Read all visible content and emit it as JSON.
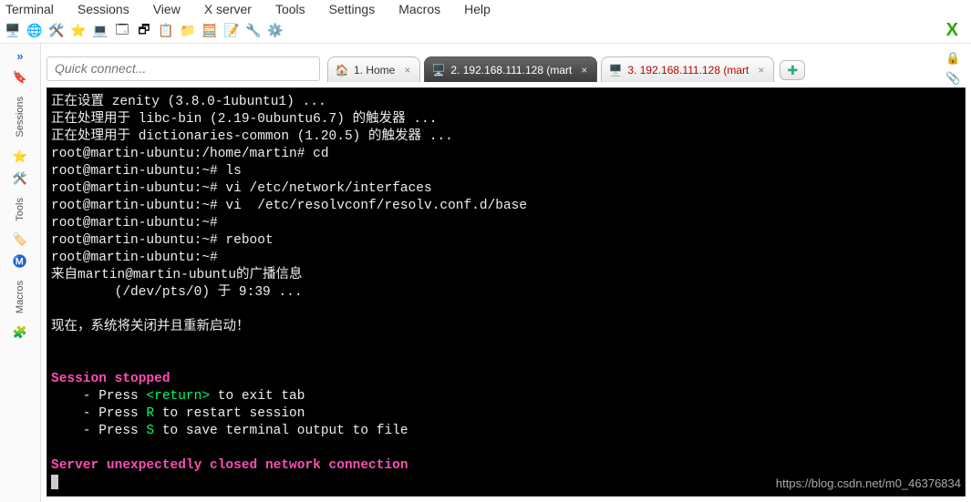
{
  "menubar": [
    "Terminal",
    "Sessions",
    "View",
    "X server",
    "Tools",
    "Settings",
    "Macros",
    "Help"
  ],
  "toolbar_icons": [
    {
      "name": "terminal-icon",
      "glyph": "🖥️"
    },
    {
      "name": "globe-icon",
      "glyph": "🌐"
    },
    {
      "name": "hammer-icon",
      "glyph": "🛠️"
    },
    {
      "name": "star-icon",
      "glyph": "⭐"
    },
    {
      "name": "monitor-icon",
      "glyph": "💻"
    },
    {
      "name": "cascade-icon",
      "glyph": "🗔"
    },
    {
      "name": "tile-icon",
      "glyph": "🗗"
    },
    {
      "name": "note-icon",
      "glyph": "📋"
    },
    {
      "name": "folder-icon",
      "glyph": "📁"
    },
    {
      "name": "calc-icon",
      "glyph": "🧮"
    },
    {
      "name": "edit-icon",
      "glyph": "📝"
    },
    {
      "name": "wrench-icon",
      "glyph": "🔧"
    },
    {
      "name": "gear-icon",
      "glyph": "⚙️"
    }
  ],
  "close_glyph": "X",
  "quick_connect_placeholder": "Quick connect...",
  "left_dock": [
    {
      "icon": "»",
      "name": "expand-icon",
      "label": ""
    },
    {
      "icon": "🔖",
      "name": "bookmark-icon",
      "label": "Sessions"
    },
    {
      "icon": "⭐",
      "name": "star-dock-icon",
      "label": ""
    },
    {
      "icon": "🛠️",
      "name": "tools-dock-icon",
      "label": "Tools"
    },
    {
      "icon": "🏷️",
      "name": "tag-dock-icon",
      "label": ""
    },
    {
      "icon": "Ⓜ️",
      "name": "macros-dock-icon",
      "label": "Macros"
    },
    {
      "icon": "🧩",
      "name": "split-dock-icon",
      "label": ""
    }
  ],
  "tabs": [
    {
      "id": "home",
      "label": "1. Home",
      "icon": "🏠",
      "active": false,
      "red": false
    },
    {
      "id": "ssh1",
      "label": "2. 192.168.111.128 (mart",
      "icon": "🖥️",
      "active": true,
      "red": false
    },
    {
      "id": "ssh2",
      "label": "3. 192.168.111.128 (mart",
      "icon": "🖥️",
      "active": false,
      "red": true
    }
  ],
  "right_icons": [
    {
      "name": "lock-icon",
      "glyph": "🔒"
    },
    {
      "name": "paperclip-icon",
      "glyph": "📎"
    }
  ],
  "terminal": {
    "lines": [
      {
        "t": "正在设置 zenity (3.8.0-1ubuntu1) ..."
      },
      {
        "t": "正在处理用于 libc-bin (2.19-0ubuntu6.7) 的触发器 ..."
      },
      {
        "t": "正在处理用于 dictionaries-common (1.20.5) 的触发器 ..."
      },
      {
        "t": "root@martin-ubuntu:/home/martin# cd"
      },
      {
        "t": "root@martin-ubuntu:~# ls"
      },
      {
        "t": "root@martin-ubuntu:~# vi /etc/network/interfaces"
      },
      {
        "t": "root@martin-ubuntu:~# vi  /etc/resolvconf/resolv.conf.d/base"
      },
      {
        "t": "root@martin-ubuntu:~#"
      },
      {
        "t": "root@martin-ubuntu:~# reboot"
      },
      {
        "t": "root@martin-ubuntu:~#"
      },
      {
        "t": "来自martin@martin-ubuntu的广播信息"
      },
      {
        "t": "        (/dev/pts/0) 于 9:39 ..."
      },
      {
        "t": " "
      },
      {
        "t": "现在，系统将关闭并且重新启动！"
      },
      {
        "t": " "
      },
      {
        "t": " "
      }
    ],
    "session_stopped": "Session stopped",
    "hint1_a": "    - Press ",
    "hint1_b": "<return>",
    "hint1_c": " to exit tab",
    "hint2_a": "    - Press ",
    "hint2_b": "R",
    "hint2_c": " to restart session",
    "hint3_a": "    - Press ",
    "hint3_b": "S",
    "hint3_c": " to save terminal output to file",
    "error_line": "Server unexpectedly closed network connection"
  },
  "watermark": "https://blog.csdn.net/m0_46376834"
}
